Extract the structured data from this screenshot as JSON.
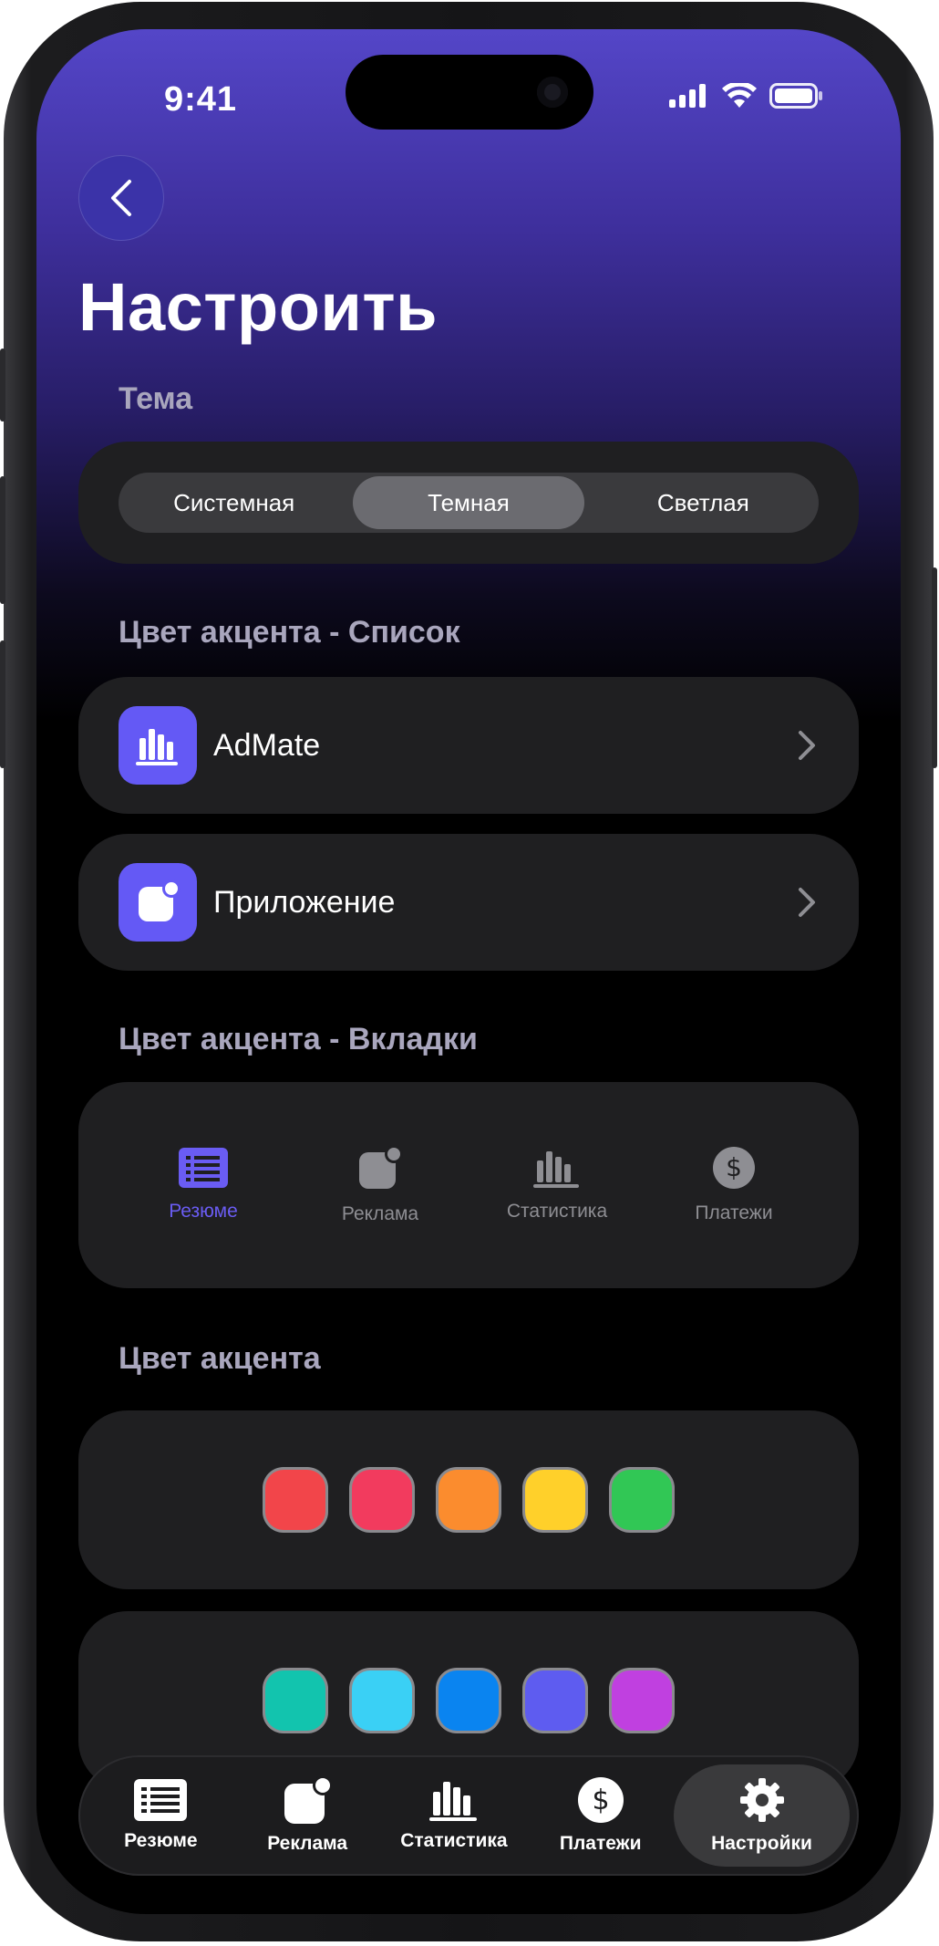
{
  "status_bar": {
    "time": "9:41"
  },
  "header": {
    "back_icon": "chevron-left-icon",
    "title": "Настроить"
  },
  "theme": {
    "label": "Тема",
    "options": [
      "Системная",
      "Темная",
      "Светлая"
    ],
    "selected": "Темная"
  },
  "accent_list": {
    "label": "Цвет акцента - Список",
    "items": [
      {
        "label": "AdMate",
        "icon": "bar-chart-icon"
      },
      {
        "label": "Приложение",
        "icon": "app-badge-icon"
      }
    ]
  },
  "accent_tabs": {
    "label": "Цвет акцента - Вкладки",
    "items": [
      {
        "label": "Резюме",
        "icon": "list-icon",
        "active": true
      },
      {
        "label": "Реклама",
        "icon": "app-badge-icon",
        "active": false
      },
      {
        "label": "Статистика",
        "icon": "bar-chart-icon",
        "active": false
      },
      {
        "label": "Платежи",
        "icon": "dollar-icon",
        "active": false
      }
    ]
  },
  "accent_color": {
    "label": "Цвет акцента",
    "row1": [
      "#f2454a",
      "#f23b5e",
      "#fb8c2e",
      "#ffd02a",
      "#31c755"
    ],
    "row2": [
      "#12c4ae",
      "#3ad0f5",
      "#0a84f0",
      "#5e5cf0",
      "#c040e0"
    ]
  },
  "tabbar": {
    "items": [
      {
        "label": "Резюме",
        "icon": "list-icon"
      },
      {
        "label": "Реклама",
        "icon": "app-badge-icon"
      },
      {
        "label": "Статистика",
        "icon": "bar-chart-icon"
      },
      {
        "label": "Платежи",
        "icon": "dollar-icon"
      },
      {
        "label": "Настройки",
        "icon": "gear-icon",
        "active": true
      }
    ]
  },
  "colors": {
    "accent": "#6a5cf3",
    "card": "#1f1f21",
    "header_gradient_top": "#5446c8"
  }
}
